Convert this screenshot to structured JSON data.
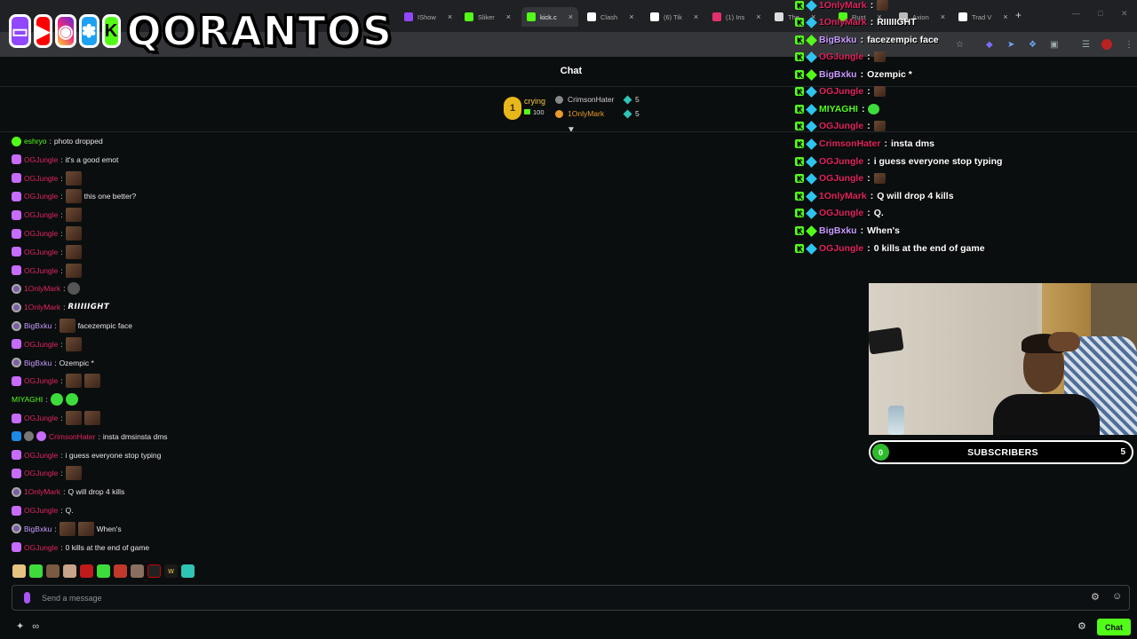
{
  "browser": {
    "tabs": [
      {
        "label": "IShow",
        "color": "#9147ff"
      },
      {
        "label": "Sliker",
        "color": "#53fc18"
      },
      {
        "label": "kick.c",
        "color": "#53fc18"
      },
      {
        "label": "Clash",
        "color": "#ffffff"
      },
      {
        "label": "(6) Tik",
        "color": "#ffffff"
      },
      {
        "label": "(1) Ins",
        "color": "#e1306c"
      },
      {
        "label": "The",
        "color": "#dddddd"
      },
      {
        "label": "Rust",
        "color": "#53fc18"
      },
      {
        "label": "Axion",
        "color": "#bbbbbb"
      },
      {
        "label": "Trad V",
        "color": "#ffffff"
      }
    ]
  },
  "logo": {
    "text": "QORANTOS"
  },
  "chat": {
    "title": "Chat",
    "leaderboard": {
      "rank": "1",
      "top_name": "crying",
      "top_amount": "100",
      "rows": [
        {
          "name": "CrimsonHater",
          "color": "#cfcfcf",
          "count": "5"
        },
        {
          "name": "1OnlyMark",
          "color": "#e89a2c",
          "count": "5"
        }
      ]
    },
    "messages": [
      {
        "user": "eshryo",
        "color": "#53fc18",
        "badge": "b-vip",
        "text": "photo dropped",
        "emotes": 0
      },
      {
        "user": "OGJungle",
        "color": "#e0245e",
        "badge": "b-sub",
        "text": "it's a good emot",
        "emotes": 0
      },
      {
        "user": "OGJungle",
        "color": "#e0245e",
        "badge": "b-sub",
        "text": "",
        "emotes": 1
      },
      {
        "user": "OGJungle",
        "color": "#e0245e",
        "badge": "b-sub",
        "text": "this one better?",
        "emotes": 1
      },
      {
        "user": "OGJungle",
        "color": "#e0245e",
        "badge": "b-sub",
        "text": "",
        "emotes": 1
      },
      {
        "user": "OGJungle",
        "color": "#e0245e",
        "badge": "b-sub",
        "text": "",
        "emotes": 1
      },
      {
        "user": "OGJungle",
        "color": "#e0245e",
        "badge": "b-sub",
        "text": "",
        "emotes": 1
      },
      {
        "user": "OGJungle",
        "color": "#e0245e",
        "badge": "b-sub",
        "text": "",
        "emotes": 1
      },
      {
        "user": "1OnlyMark",
        "color": "#e0245e",
        "badge": "b-og",
        "text": "",
        "emotes": 1,
        "grey": true
      },
      {
        "user": "1OnlyMark",
        "color": "#e0245e",
        "badge": "b-og",
        "text": "RIIIIIGHT",
        "emotes": 0,
        "styled": true
      },
      {
        "user": "BigBxku",
        "color": "#c89bff",
        "badge": "b-og",
        "text": "facezempic face",
        "emotes": 1
      },
      {
        "user": "OGJungle",
        "color": "#e0245e",
        "badge": "b-sub",
        "text": "",
        "emotes": 1
      },
      {
        "user": "BigBxku",
        "color": "#c89bff",
        "badge": "b-og",
        "text": "Ozempic *",
        "emotes": 0
      },
      {
        "user": "OGJungle",
        "color": "#e0245e",
        "badge": "b-sub",
        "text": "",
        "emotes": 2
      },
      {
        "user": "MIYAGHI",
        "color": "#53fc18",
        "badge": "",
        "text": "",
        "emotes": 2,
        "green": true
      },
      {
        "user": "OGJungle",
        "color": "#e0245e",
        "badge": "b-sub",
        "text": "",
        "emotes": 2
      },
      {
        "user": "CrimsonHater",
        "color": "#e0245e",
        "badge": "b-mod",
        "text": "insta dmsinsta dms",
        "emotes": 0
      },
      {
        "user": "OGJungle",
        "color": "#e0245e",
        "badge": "b-sub",
        "text": "i guess everyone stop typing",
        "emotes": 0
      },
      {
        "user": "OGJungle",
        "color": "#e0245e",
        "badge": "b-sub",
        "text": "",
        "emotes": 1
      },
      {
        "user": "1OnlyMark",
        "color": "#e0245e",
        "badge": "b-og",
        "text": "Q will drop 4 kills",
        "emotes": 0
      },
      {
        "user": "OGJungle",
        "color": "#e0245e",
        "badge": "b-sub",
        "text": "Q.",
        "emotes": 0
      },
      {
        "user": "BigBxku",
        "color": "#c89bff",
        "badge": "b-og",
        "text": "When's",
        "emotes": 2
      },
      {
        "user": "OGJungle",
        "color": "#e0245e",
        "badge": "b-sub",
        "text": "0 kills at the end of game",
        "emotes": 0
      }
    ],
    "input_placeholder": "Send a message",
    "chat_button": "Chat"
  },
  "overlay_chat": [
    {
      "user": "1OnlyMark",
      "color": "#e0245e",
      "text": ""
    },
    {
      "user": "1OnlyMark",
      "color": "#e0245e",
      "text": "RIIIIIGHT"
    },
    {
      "user": "BigBxku",
      "color": "#c89bff",
      "text": "facezempic face"
    },
    {
      "user": "OGJungle",
      "color": "#e0245e",
      "text": ""
    },
    {
      "user": "BigBxku",
      "color": "#c89bff",
      "text": "Ozempic *"
    },
    {
      "user": "OGJungle",
      "color": "#e0245e",
      "text": ""
    },
    {
      "user": "MIYAGHI",
      "color": "#53fc18",
      "text": ""
    },
    {
      "user": "OGJungle",
      "color": "#e0245e",
      "text": ""
    },
    {
      "user": "CrimsonHater",
      "color": "#e0245e",
      "text": "insta dms"
    },
    {
      "user": "OGJungle",
      "color": "#e0245e",
      "text": "i guess everyone stop typing"
    },
    {
      "user": "OGJungle",
      "color": "#e0245e",
      "text": ""
    },
    {
      "user": "1OnlyMark",
      "color": "#e0245e",
      "text": "Q will drop 4 kills"
    },
    {
      "user": "OGJungle",
      "color": "#e0245e",
      "text": "Q."
    },
    {
      "user": "BigBxku",
      "color": "#c89bff",
      "text": "When's"
    },
    {
      "user": "OGJungle",
      "color": "#e0245e",
      "text": "0 kills at the end of game"
    }
  ],
  "subscribers": {
    "current": "0",
    "label": "SUBSCRIBERS",
    "goal": "5"
  }
}
